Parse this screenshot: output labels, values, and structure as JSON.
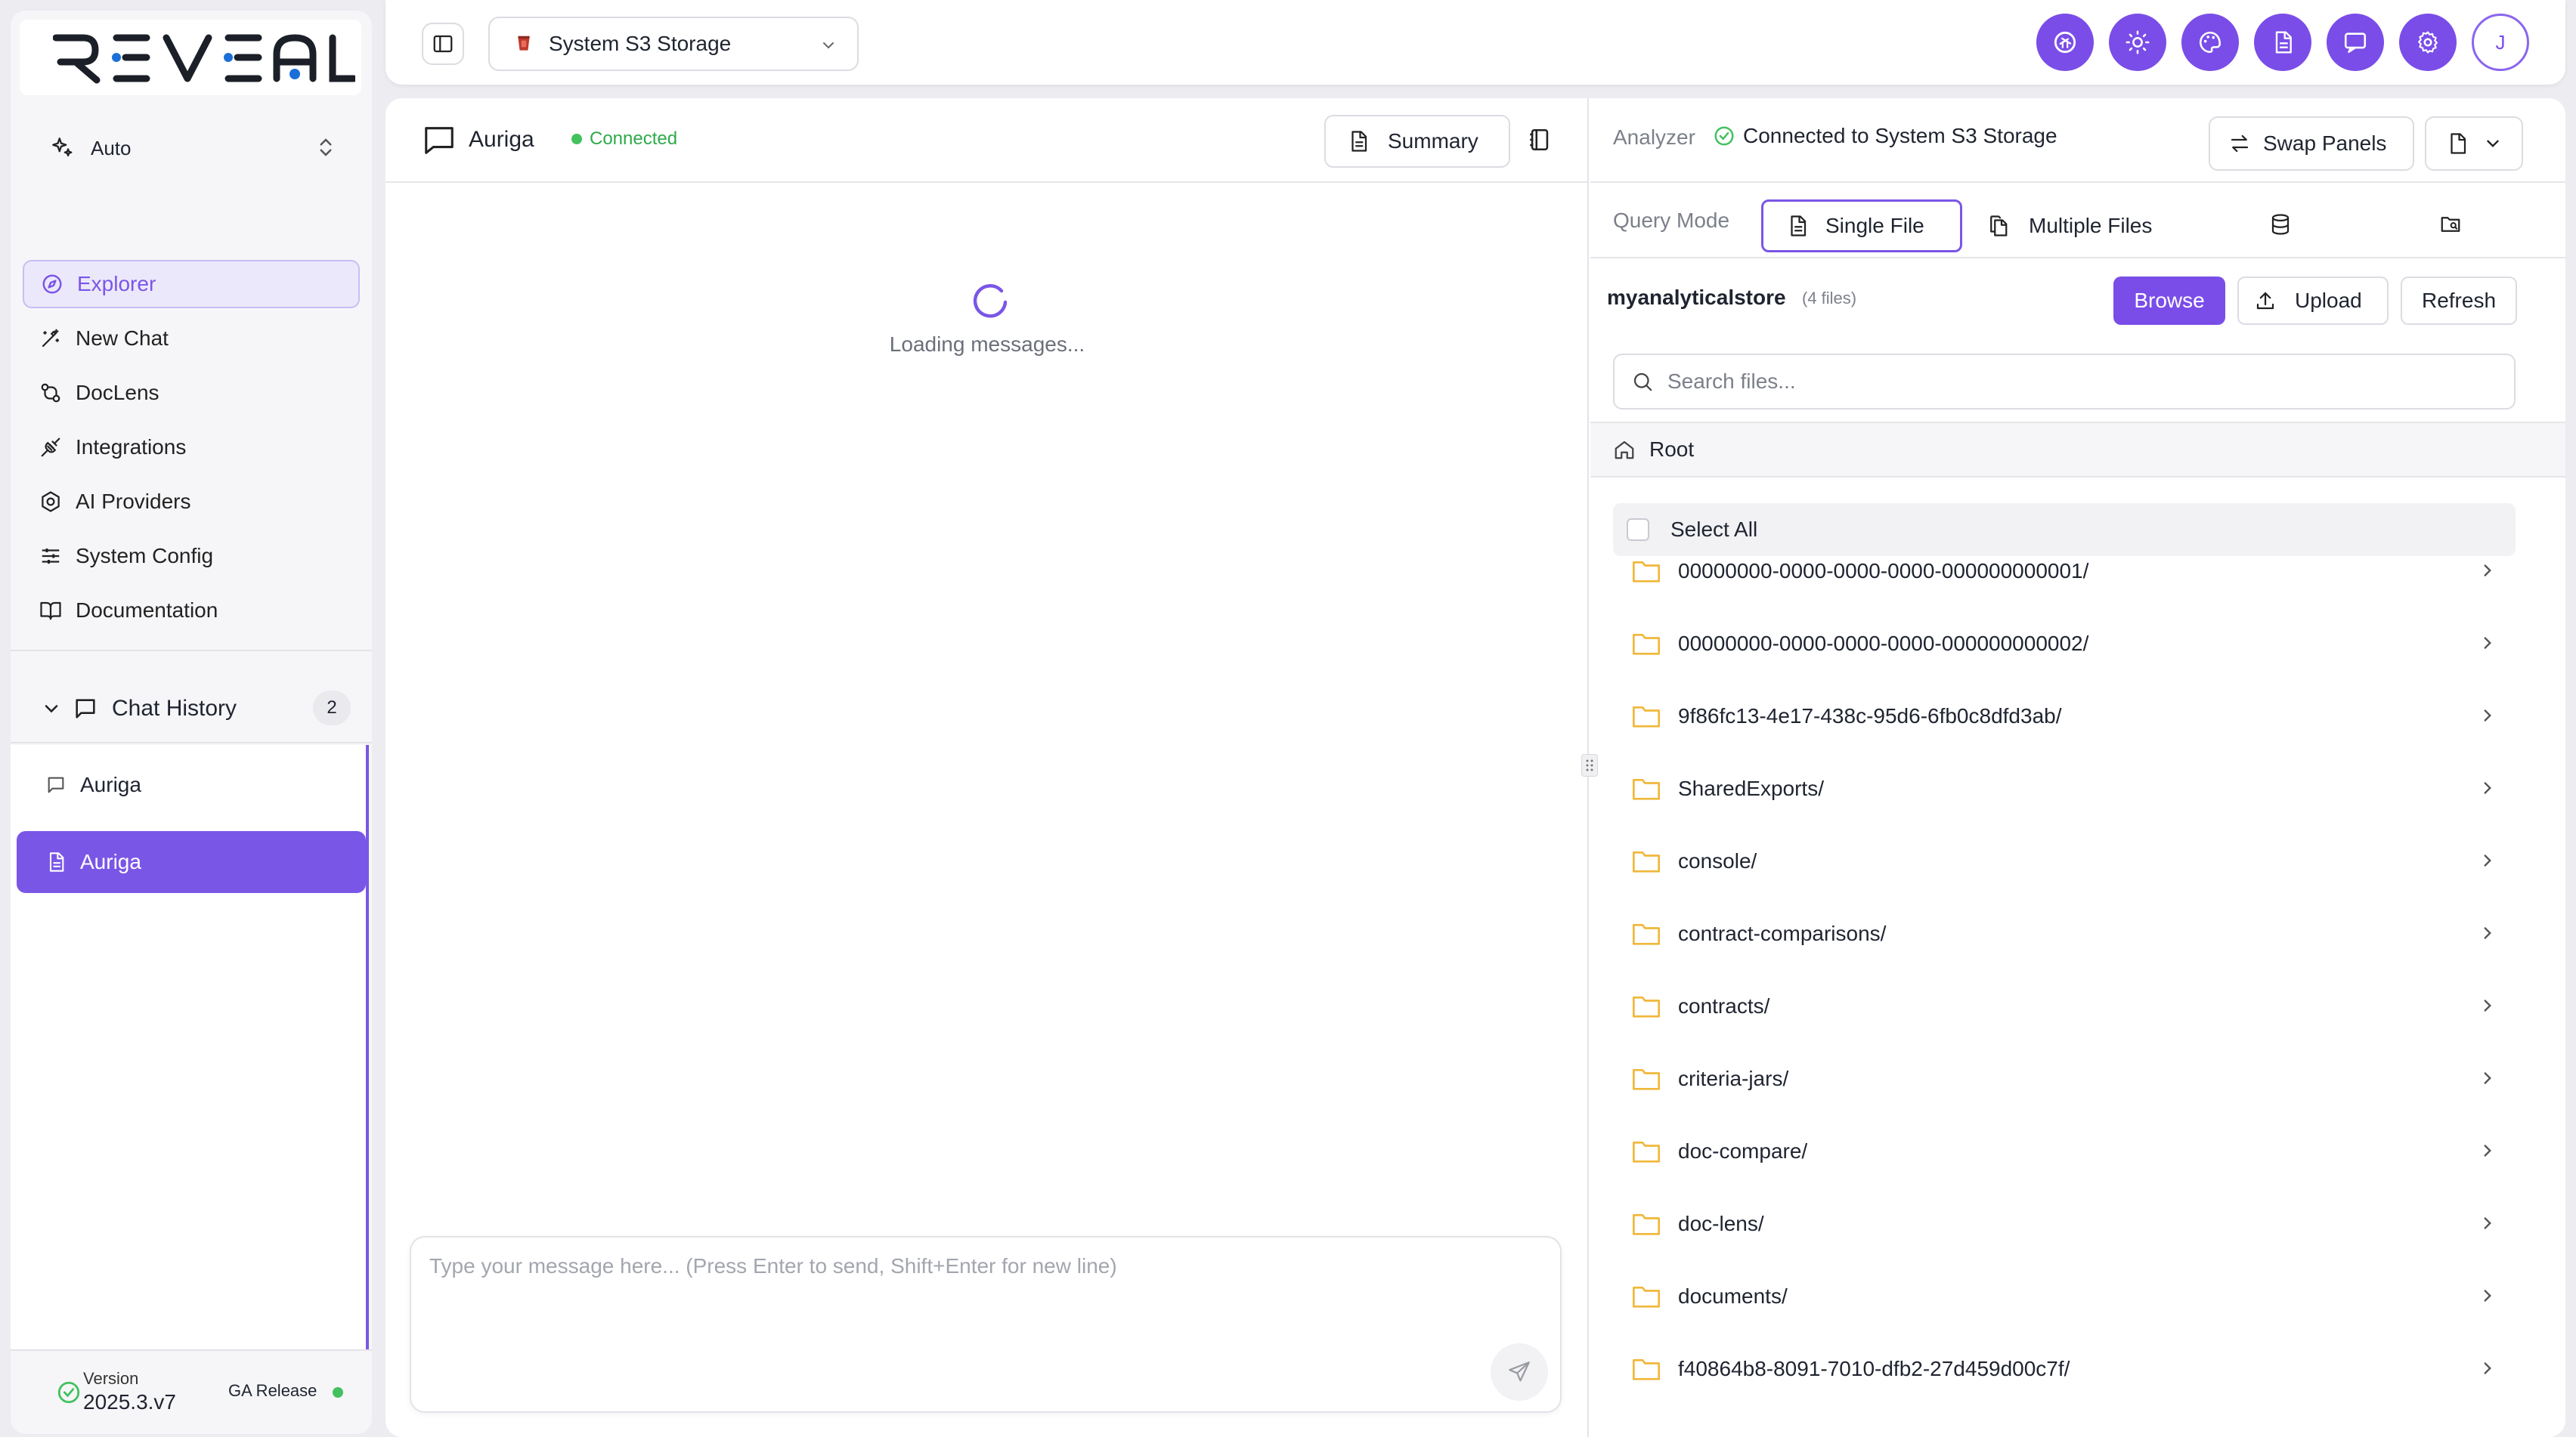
{
  "brand": {
    "logo_text": "REVEAL"
  },
  "mode_selector": {
    "label": "Auto"
  },
  "nav": [
    {
      "label": "Explorer",
      "icon": "compass-icon",
      "active": true
    },
    {
      "label": "New Chat",
      "icon": "magic-wand-icon"
    },
    {
      "label": "DocLens",
      "icon": "doclens-icon"
    },
    {
      "label": "Integrations",
      "icon": "plug-icon"
    },
    {
      "label": "AI Providers",
      "icon": "hexagon-icon"
    },
    {
      "label": "System Config",
      "icon": "sliders-icon"
    },
    {
      "label": "Documentation",
      "icon": "book-open-icon"
    }
  ],
  "chat_history": {
    "label": "Chat History",
    "count": "2",
    "items": [
      {
        "label": "Auriga",
        "icon": "message-icon",
        "active": false
      },
      {
        "label": "Auriga",
        "icon": "file-text-icon",
        "active": true
      }
    ]
  },
  "footer": {
    "version_label": "Version",
    "version": "2025.3.v7",
    "release": "GA Release"
  },
  "topbar": {
    "storage": "System S3 Storage",
    "actions": [
      "openai-icon",
      "sun-icon",
      "palette-icon",
      "document-icon",
      "chat-icon",
      "settings-icon"
    ],
    "avatar_initial": "J"
  },
  "chat": {
    "title": "Auriga",
    "status": "Connected",
    "summary_label": "Summary",
    "loading": "Loading messages...",
    "placeholder": "Type your message here... (Press Enter to send, Shift+Enter for new line)"
  },
  "analyzer": {
    "label": "Analyzer",
    "status": "Connected to System S3 Storage",
    "swap_label": "Swap Panels",
    "query_mode_label": "Query Mode",
    "single_file": "Single File",
    "multiple_files": "Multiple Files",
    "store_name": "myanalyticalstore",
    "file_count": "(4 files)",
    "browse": "Browse",
    "upload": "Upload",
    "refresh": "Refresh",
    "search_placeholder": "Search files...",
    "root": "Root",
    "select_all": "Select All",
    "folders": [
      "00000000-0000-0000-0000-000000000001/",
      "00000000-0000-0000-0000-000000000002/",
      "9f86fc13-4e17-438c-95d6-6fb0c8dfd3ab/",
      "SharedExports/",
      "console/",
      "contract-comparisons/",
      "contracts/",
      "criteria-jars/",
      "doc-compare/",
      "doc-lens/",
      "documents/",
      "f40864b8-8091-7010-dfb2-27d459d00c7f/"
    ]
  },
  "colors": {
    "accent": "#7a4de8",
    "connected": "#43c15f",
    "folder": "#f0b73a"
  }
}
